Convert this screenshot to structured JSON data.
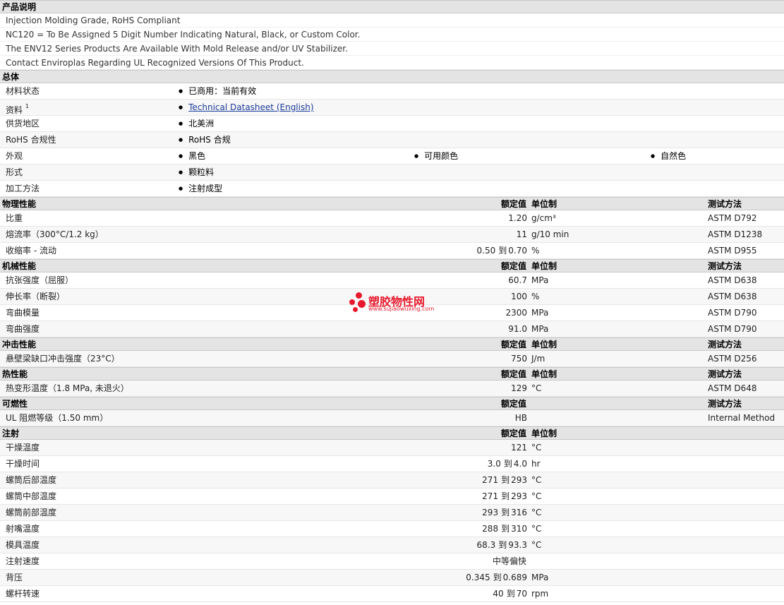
{
  "description": {
    "title": "产品说明",
    "lines": [
      "Injection Molding Grade, RoHS Compliant",
      "NC120 = To Be Assigned 5 Digit Number Indicating Natural, Black, or Custom Color.",
      "The ENV12 Series Products Are Available With Mold Release and/or UV Stabilizer.",
      "Contact Enviroplas Regarding UL Recognized Versions Of This Product."
    ]
  },
  "general": {
    "title": "总体",
    "material_status": {
      "label": "材料状态",
      "value": "已商用：当前有效"
    },
    "literature": {
      "label": "资料",
      "sup": "1",
      "value": "Technical Datasheet (English)"
    },
    "availability": {
      "label": "供货地区",
      "value": "北美洲"
    },
    "rohs": {
      "label": "RoHS 合规性",
      "value": "RoHS 合规"
    },
    "appearance": {
      "label": "外观",
      "values": [
        "黑色",
        "可用颜色",
        "自然色"
      ]
    },
    "form": {
      "label": "形式",
      "value": "颗粒料"
    },
    "processing": {
      "label": "加工方法",
      "value": "注射成型"
    }
  },
  "headers": {
    "nominal": "额定值",
    "unit": "单位制",
    "test": "测试方法",
    "to": "到"
  },
  "physical": {
    "title": "物理性能",
    "rows": [
      {
        "label": "比重",
        "value": "1.20",
        "unit": "g/cm³",
        "test": "ASTM D792"
      },
      {
        "label": "熔流率（300°C/1.2 kg）",
        "value": "11",
        "unit": "g/10 min",
        "test": "ASTM D1238"
      },
      {
        "label": "收缩率 - 流动",
        "min": "0.50",
        "max": "0.70",
        "unit": "%",
        "test": "ASTM D955"
      }
    ]
  },
  "mechanical": {
    "title": "机械性能",
    "rows": [
      {
        "label": "抗张强度（屈服）",
        "value": "60.7",
        "unit": "MPa",
        "test": "ASTM D638"
      },
      {
        "label": "伸长率（断裂）",
        "value": "100",
        "unit": "%",
        "test": "ASTM D638"
      },
      {
        "label": "弯曲模量",
        "value": "2300",
        "unit": "MPa",
        "test": "ASTM D790"
      },
      {
        "label": "弯曲强度",
        "value": "91.0",
        "unit": "MPa",
        "test": "ASTM D790"
      }
    ]
  },
  "impact": {
    "title": "冲击性能",
    "rows": [
      {
        "label": "悬壁梁缺口冲击强度（23°C）",
        "value": "750",
        "unit": "J/m",
        "test": "ASTM D256"
      }
    ]
  },
  "thermal": {
    "title": "热性能",
    "rows": [
      {
        "label": "热变形温度（1.8 MPa, 未退火）",
        "value": "129",
        "unit": "°C",
        "test": "ASTM D648"
      }
    ]
  },
  "flammability": {
    "title": "可燃性",
    "rows": [
      {
        "label": "UL 阻燃等级（1.50 mm）",
        "value": "HB",
        "test": "Internal Method"
      }
    ]
  },
  "injection": {
    "title": "注射",
    "rows": [
      {
        "label": "干燥温度",
        "value": "121",
        "unit": "°C"
      },
      {
        "label": "干燥时间",
        "min": "3.0",
        "max": "4.0",
        "unit": "hr"
      },
      {
        "label": "螺筒后部温度",
        "min": "271",
        "max": "293",
        "unit": "°C"
      },
      {
        "label": "螺筒中部温度",
        "min": "271",
        "max": "293",
        "unit": "°C"
      },
      {
        "label": "螺筒前部温度",
        "min": "293",
        "max": "316",
        "unit": "°C"
      },
      {
        "label": "射嘴温度",
        "min": "288",
        "max": "310",
        "unit": "°C"
      },
      {
        "label": "模具温度",
        "min": "68.3",
        "max": "93.3",
        "unit": "°C"
      },
      {
        "label": "注射速度",
        "center": "中等偏快"
      },
      {
        "label": "背压",
        "min": "0.345",
        "max": "0.689",
        "unit": "MPa"
      },
      {
        "label": "螺杆转速",
        "min": "40",
        "max": "70",
        "unit": "rpm"
      }
    ]
  },
  "watermark": {
    "name": "塑胶物性网",
    "url": "www.sujiaowuxing.com",
    "color": "#e8192c"
  }
}
